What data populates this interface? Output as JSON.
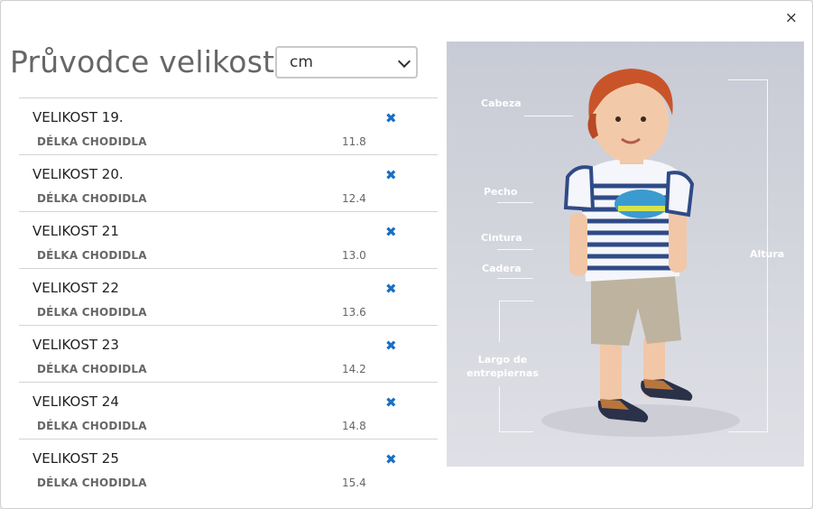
{
  "modal": {
    "close_label": "×",
    "title": "Průvodce velikostí",
    "unit_select": {
      "value": "cm"
    }
  },
  "sizes": [
    {
      "name": "VELIKOST 19.",
      "measure_label": "DÉLKA CHODIDLA",
      "value": "11.8",
      "remove_icon": "✖"
    },
    {
      "name": "VELIKOST 20.",
      "measure_label": "DÉLKA CHODIDLA",
      "value": "12.4",
      "remove_icon": "✖"
    },
    {
      "name": "VELIKOST 21",
      "measure_label": "DÉLKA CHODIDLA",
      "value": "13.0",
      "remove_icon": "✖"
    },
    {
      "name": "VELIKOST 22",
      "measure_label": "DÉLKA CHODIDLA",
      "value": "13.6",
      "remove_icon": "✖"
    },
    {
      "name": "VELIKOST 23",
      "measure_label": "DÉLKA CHODIDLA",
      "value": "14.2",
      "remove_icon": "✖"
    },
    {
      "name": "VELIKOST 24",
      "measure_label": "DÉLKA CHODIDLA",
      "value": "14.8",
      "remove_icon": "✖"
    },
    {
      "name": "VELIKOST 25",
      "measure_label": "DÉLKA CHODIDLA",
      "value": "15.4",
      "remove_icon": "✖"
    }
  ],
  "photo": {
    "labels": {
      "head": "Cabeza",
      "chest": "Pecho",
      "waist": "Cintura",
      "hip": "Cadera",
      "inseam": "Largo de entrepiernas",
      "height": "Altura"
    }
  },
  "colors": {
    "remove_icon": "#1a6fc4"
  }
}
